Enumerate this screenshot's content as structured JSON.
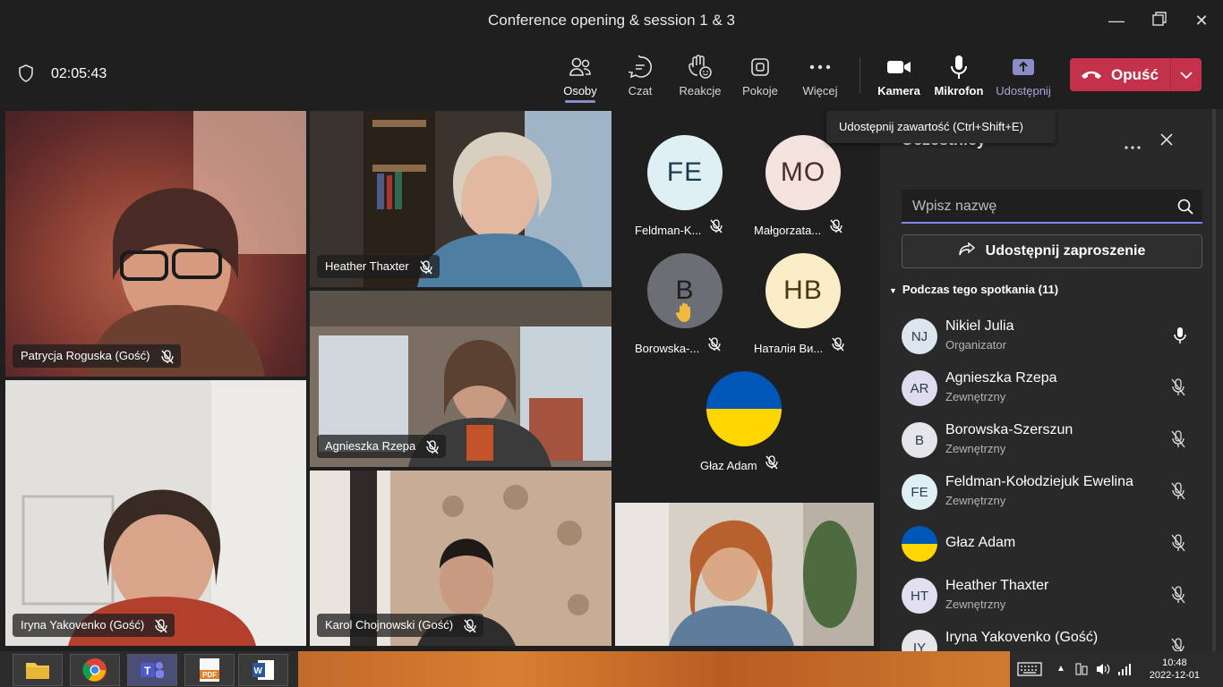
{
  "window": {
    "title": "Conference opening & session 1 & 3"
  },
  "toolbar": {
    "timer": "02:05:43",
    "buttons": [
      {
        "label": "Osoby",
        "icon": "people-icon"
      },
      {
        "label": "Czat",
        "icon": "chat-icon"
      },
      {
        "label": "Reakcje",
        "icon": "reactions-icon"
      },
      {
        "label": "Pokoje",
        "icon": "rooms-icon"
      },
      {
        "label": "Więcej",
        "icon": "more-icon"
      },
      {
        "label": "Kamera",
        "icon": "camera-icon"
      },
      {
        "label": "Mikrofon",
        "icon": "microphone-icon"
      },
      {
        "label": "Udostępnij",
        "icon": "share-icon"
      }
    ],
    "leave_label": "Opuść",
    "share_tooltip": "Udostępnij zawartość (Ctrl+Shift+E)"
  },
  "stage": {
    "video_tiles": [
      {
        "name": "Patrycja Roguska (Gość)"
      },
      {
        "name": "Heather Thaxter"
      },
      {
        "name": "Agnieszka Rzepa"
      },
      {
        "name": "Iryna Yakovenko (Gość)"
      },
      {
        "name": "Karol Chojnowski (Gość)"
      }
    ],
    "avatars": [
      {
        "initials": "FE",
        "name": "Feldman-K...",
        "color": "#dff0f4"
      },
      {
        "initials": "MO",
        "name": "Małgorzata...",
        "color": "#f4e2de"
      },
      {
        "initials": "B",
        "name": "Borowska-...",
        "color": "#6b6e75"
      },
      {
        "initials": "HB",
        "name": "Наталія Ви...",
        "color": "#fbedc8"
      },
      {
        "initials": "",
        "name": "Głaz Adam",
        "color": "#0057b7"
      }
    ]
  },
  "panel": {
    "title": "Uczestnicy",
    "search_placeholder": "Wpisz nazwę",
    "invite_label": "Udostępnij zaproszenie",
    "section_label": "Podczas tego spotkania (11)",
    "participants": [
      {
        "initials": "NJ",
        "name": "Nikiel Julia",
        "role": "Organizator",
        "mic": "on"
      },
      {
        "initials": "AR",
        "name": "Agnieszka Rzepa",
        "role": "Zewnętrzny",
        "mic": "off"
      },
      {
        "initials": "B",
        "name": "Borowska-Szerszun",
        "role": "Zewnętrzny",
        "mic": "off"
      },
      {
        "initials": "FE",
        "name": "Feldman-Kołodziejuk Ewelina",
        "role": "Zewnętrzny",
        "mic": "off"
      },
      {
        "initials": "",
        "name": "Głaz Adam",
        "role": "",
        "mic": "off"
      },
      {
        "initials": "HT",
        "name": "Heather Thaxter",
        "role": "Zewnętrzny",
        "mic": "off"
      },
      {
        "initials": "IY",
        "name": "Iryna Yakovenko (Gość)",
        "role": "",
        "mic": "off"
      }
    ]
  },
  "taskbar": {
    "time": "10:48",
    "date": "2022-12-01",
    "apps": [
      "file-explorer-icon",
      "chrome-icon",
      "teams-icon",
      "pdf-icon",
      "word-icon"
    ]
  },
  "colors": {
    "accent": "#7f85f5",
    "leave": "#c4314b"
  }
}
